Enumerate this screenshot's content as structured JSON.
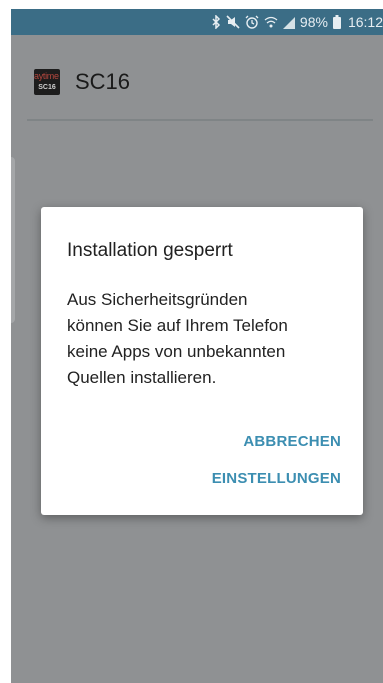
{
  "status_bar": {
    "icons": [
      "bluetooth-icon",
      "mute-icon",
      "alarm-icon",
      "wifi-icon",
      "signal-icon",
      "battery-icon"
    ],
    "battery_percent": "98%",
    "time": "16:12"
  },
  "app": {
    "logo_text_top": "aytime",
    "logo_text_bottom": "SC16",
    "title": "SC16"
  },
  "dialog": {
    "title": "Installation gesperrt",
    "message_lines": [
      "Aus Sicherheitsgründen",
      "können Sie auf Ihrem Telefon",
      "keine Apps von unbekannten",
      "Quellen installieren."
    ],
    "cancel_label": "ABBRECHEN",
    "settings_label": "EINSTELLUNGEN"
  },
  "colors": {
    "status_bar": "#3b6d86",
    "scrim_background": "#8f9193",
    "dialog_button": "#3c8eb1"
  }
}
